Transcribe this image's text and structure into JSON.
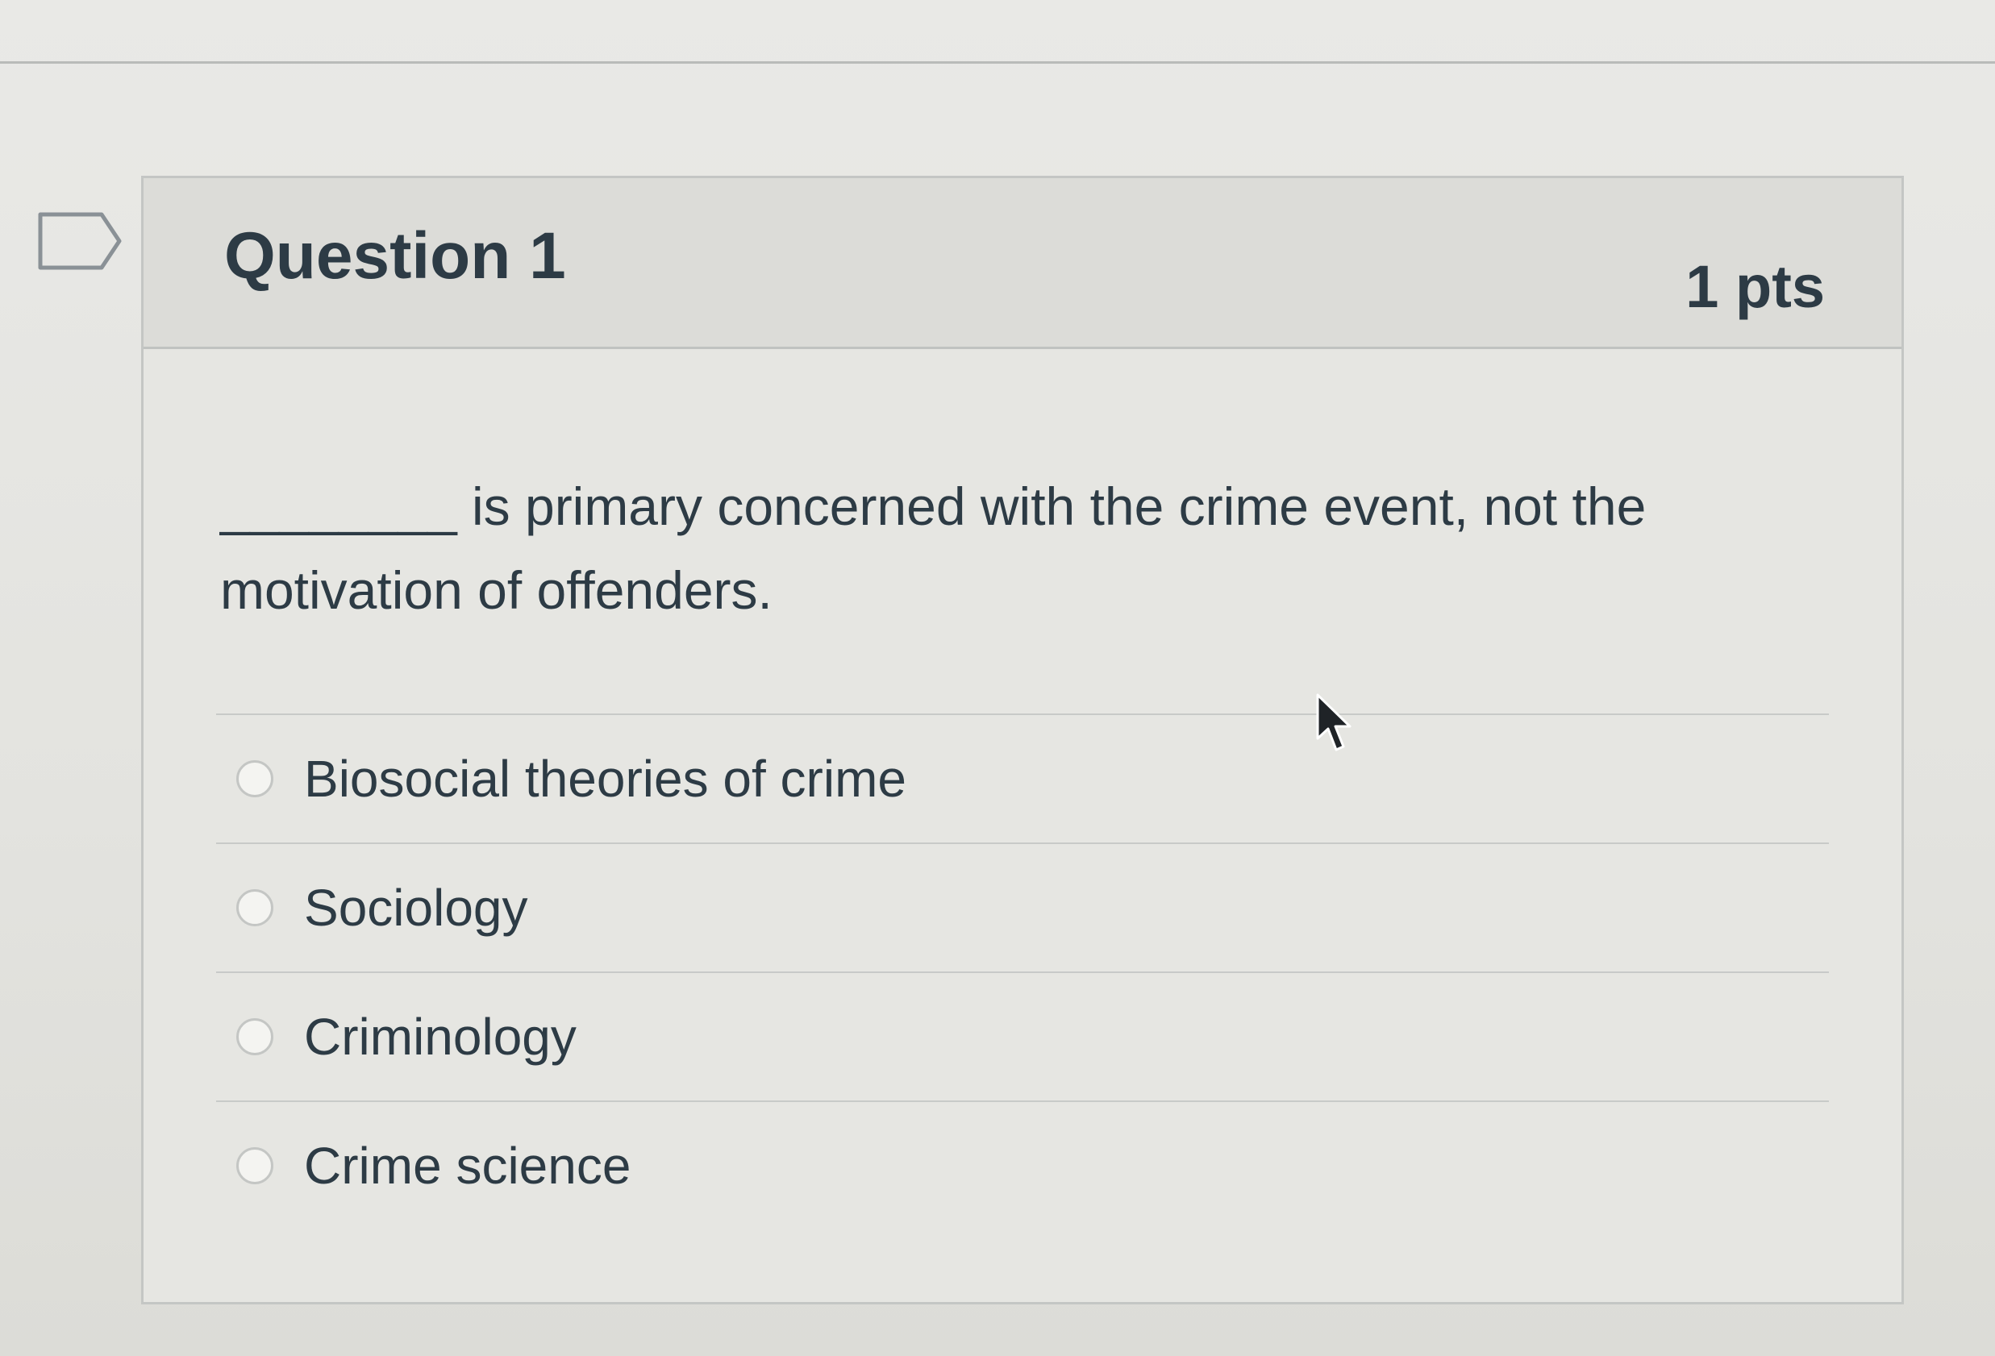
{
  "question": {
    "title": "Question 1",
    "points": "1 pts",
    "text": "________ is primary concerned with the crime event, not the motivation of offenders.",
    "answers": [
      {
        "label": "Biosocial theories of crime"
      },
      {
        "label": "Sociology"
      },
      {
        "label": "Criminology"
      },
      {
        "label": "Crime science"
      }
    ]
  },
  "icons": {
    "flag": "flag-question-icon",
    "cursor": "mouse-pointer-icon"
  },
  "colors": {
    "text": "#2d3b45",
    "background": "#e6e6e2",
    "border": "#c4c6c4"
  }
}
